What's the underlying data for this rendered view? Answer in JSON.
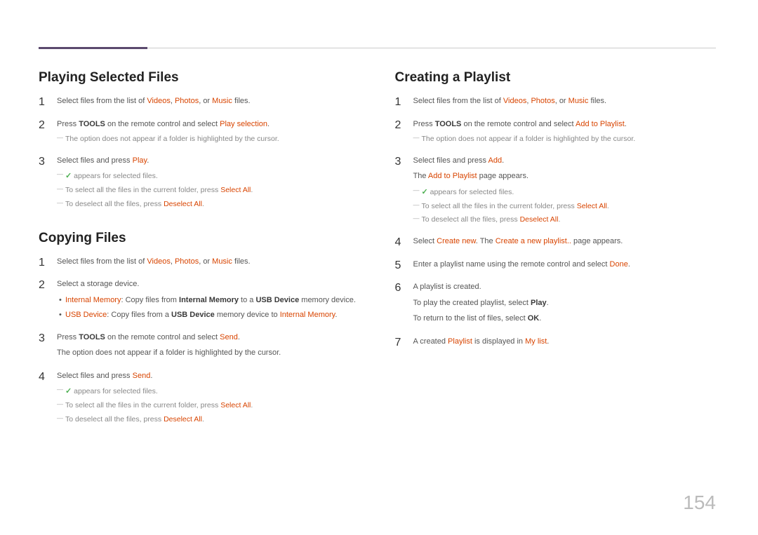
{
  "page_number": "154",
  "left": {
    "section1": {
      "title": "Playing Selected Files",
      "steps": [
        {
          "num": "1",
          "lines": [
            {
              "parts": [
                {
                  "t": "Select files from the list of "
                },
                {
                  "t": "Videos",
                  "cls": "hl"
                },
                {
                  "t": ", "
                },
                {
                  "t": "Photos",
                  "cls": "hl"
                },
                {
                  "t": ", or "
                },
                {
                  "t": "Music",
                  "cls": "hl"
                },
                {
                  "t": " files."
                }
              ]
            }
          ]
        },
        {
          "num": "2",
          "lines": [
            {
              "parts": [
                {
                  "t": "Press "
                },
                {
                  "t": "TOOLS",
                  "cls": "b"
                },
                {
                  "t": " on the remote control and select "
                },
                {
                  "t": "Play selection",
                  "cls": "hl"
                },
                {
                  "t": "."
                }
              ]
            }
          ],
          "notes": [
            {
              "parts": [
                {
                  "t": "The option does not appear if a folder is highlighted by the cursor."
                }
              ]
            }
          ]
        },
        {
          "num": "3",
          "lines": [
            {
              "parts": [
                {
                  "t": "Select files and press "
                },
                {
                  "t": "Play",
                  "cls": "hl"
                },
                {
                  "t": "."
                }
              ]
            }
          ],
          "notes": [
            {
              "parts": [
                {
                  "t": "✓",
                  "cls": "check"
                },
                {
                  "t": " appears for selected files."
                }
              ]
            },
            {
              "parts": [
                {
                  "t": "To select all the files in the current folder, press "
                },
                {
                  "t": "Select All",
                  "cls": "hl"
                },
                {
                  "t": "."
                }
              ]
            },
            {
              "parts": [
                {
                  "t": "To deselect all the files, press "
                },
                {
                  "t": "Deselect All",
                  "cls": "hl"
                },
                {
                  "t": "."
                }
              ]
            }
          ]
        }
      ]
    },
    "section2": {
      "title": "Copying Files",
      "steps": [
        {
          "num": "1",
          "lines": [
            {
              "parts": [
                {
                  "t": "Select files from the list of "
                },
                {
                  "t": "Videos",
                  "cls": "hl"
                },
                {
                  "t": ", "
                },
                {
                  "t": "Photos",
                  "cls": "hl"
                },
                {
                  "t": ", or "
                },
                {
                  "t": "Music",
                  "cls": "hl"
                },
                {
                  "t": " files."
                }
              ]
            }
          ]
        },
        {
          "num": "2",
          "lines": [
            {
              "parts": [
                {
                  "t": "Select a storage device."
                }
              ]
            }
          ],
          "bullets": [
            {
              "parts": [
                {
                  "t": "Internal Memory",
                  "cls": "hl"
                },
                {
                  "t": ": Copy files from "
                },
                {
                  "t": "Internal Memory",
                  "cls": "b"
                },
                {
                  "t": " to a "
                },
                {
                  "t": "USB Device",
                  "cls": "b"
                },
                {
                  "t": " memory device."
                }
              ]
            },
            {
              "parts": [
                {
                  "t": "USB Device",
                  "cls": "hl"
                },
                {
                  "t": ": Copy files from a "
                },
                {
                  "t": "USB Device",
                  "cls": "b"
                },
                {
                  "t": " memory device to "
                },
                {
                  "t": "Internal Memory",
                  "cls": "hl"
                },
                {
                  "t": "."
                }
              ]
            }
          ]
        },
        {
          "num": "3",
          "lines": [
            {
              "parts": [
                {
                  "t": "Press "
                },
                {
                  "t": "TOOLS",
                  "cls": "b"
                },
                {
                  "t": " on the remote control and select "
                },
                {
                  "t": "Send",
                  "cls": "hl"
                },
                {
                  "t": "."
                }
              ]
            },
            {
              "parts": [
                {
                  "t": "The option does not appear if a folder is highlighted by the cursor."
                }
              ]
            }
          ]
        },
        {
          "num": "4",
          "lines": [
            {
              "parts": [
                {
                  "t": "Select files and press "
                },
                {
                  "t": "Send",
                  "cls": "hl"
                },
                {
                  "t": "."
                }
              ]
            }
          ],
          "notes": [
            {
              "parts": [
                {
                  "t": "✓",
                  "cls": "check"
                },
                {
                  "t": " appears for selected files."
                }
              ]
            },
            {
              "parts": [
                {
                  "t": "To select all the files in the current folder, press "
                },
                {
                  "t": "Select All",
                  "cls": "hl"
                },
                {
                  "t": "."
                }
              ]
            },
            {
              "parts": [
                {
                  "t": "To deselect all the files, press "
                },
                {
                  "t": "Deselect All",
                  "cls": "hl"
                },
                {
                  "t": "."
                }
              ]
            }
          ]
        }
      ]
    }
  },
  "right": {
    "section1": {
      "title": "Creating a Playlist",
      "steps": [
        {
          "num": "1",
          "lines": [
            {
              "parts": [
                {
                  "t": "Select files from the list of "
                },
                {
                  "t": "Videos",
                  "cls": "hl"
                },
                {
                  "t": ", "
                },
                {
                  "t": "Photos",
                  "cls": "hl"
                },
                {
                  "t": ", or "
                },
                {
                  "t": "Music",
                  "cls": "hl"
                },
                {
                  "t": " files."
                }
              ]
            }
          ]
        },
        {
          "num": "2",
          "lines": [
            {
              "parts": [
                {
                  "t": "Press "
                },
                {
                  "t": "TOOLS",
                  "cls": "b"
                },
                {
                  "t": " on the remote control and select "
                },
                {
                  "t": "Add to Playlist",
                  "cls": "hl"
                },
                {
                  "t": "."
                }
              ]
            }
          ],
          "notes": [
            {
              "parts": [
                {
                  "t": "The option does not appear if a folder is highlighted by the cursor."
                }
              ]
            }
          ]
        },
        {
          "num": "3",
          "lines": [
            {
              "parts": [
                {
                  "t": "Select files and press "
                },
                {
                  "t": "Add",
                  "cls": "hl"
                },
                {
                  "t": "."
                }
              ]
            },
            {
              "parts": [
                {
                  "t": "The "
                },
                {
                  "t": "Add to Playlist",
                  "cls": "hl"
                },
                {
                  "t": " page appears."
                }
              ]
            }
          ],
          "notes": [
            {
              "parts": [
                {
                  "t": "✓",
                  "cls": "check"
                },
                {
                  "t": " appears for selected files."
                }
              ]
            },
            {
              "parts": [
                {
                  "t": "To select all the files in the current folder, press "
                },
                {
                  "t": "Select All",
                  "cls": "hl"
                },
                {
                  "t": "."
                }
              ]
            },
            {
              "parts": [
                {
                  "t": "To deselect all the files, press "
                },
                {
                  "t": "Deselect All",
                  "cls": "hl"
                },
                {
                  "t": "."
                }
              ]
            }
          ]
        },
        {
          "num": "4",
          "lines": [
            {
              "parts": [
                {
                  "t": "Select "
                },
                {
                  "t": "Create new",
                  "cls": "hl"
                },
                {
                  "t": ". The "
                },
                {
                  "t": "Create a new playlist..",
                  "cls": "hl"
                },
                {
                  "t": " page appears."
                }
              ]
            }
          ]
        },
        {
          "num": "5",
          "lines": [
            {
              "parts": [
                {
                  "t": "Enter a playlist name using the remote control and select "
                },
                {
                  "t": "Done",
                  "cls": "hl"
                },
                {
                  "t": "."
                }
              ]
            }
          ]
        },
        {
          "num": "6",
          "lines": [
            {
              "parts": [
                {
                  "t": "A playlist is created."
                }
              ]
            },
            {
              "parts": [
                {
                  "t": "To play the created playlist, select "
                },
                {
                  "t": "Play",
                  "cls": "b"
                },
                {
                  "t": "."
                }
              ]
            },
            {
              "parts": [
                {
                  "t": "To return to the list of files, select "
                },
                {
                  "t": "OK",
                  "cls": "b"
                },
                {
                  "t": "."
                }
              ]
            }
          ]
        },
        {
          "num": "7",
          "lines": [
            {
              "parts": [
                {
                  "t": "A created "
                },
                {
                  "t": "Playlist",
                  "cls": "hl"
                },
                {
                  "t": " is displayed in "
                },
                {
                  "t": "My list",
                  "cls": "hl"
                },
                {
                  "t": "."
                }
              ]
            }
          ]
        }
      ]
    }
  }
}
